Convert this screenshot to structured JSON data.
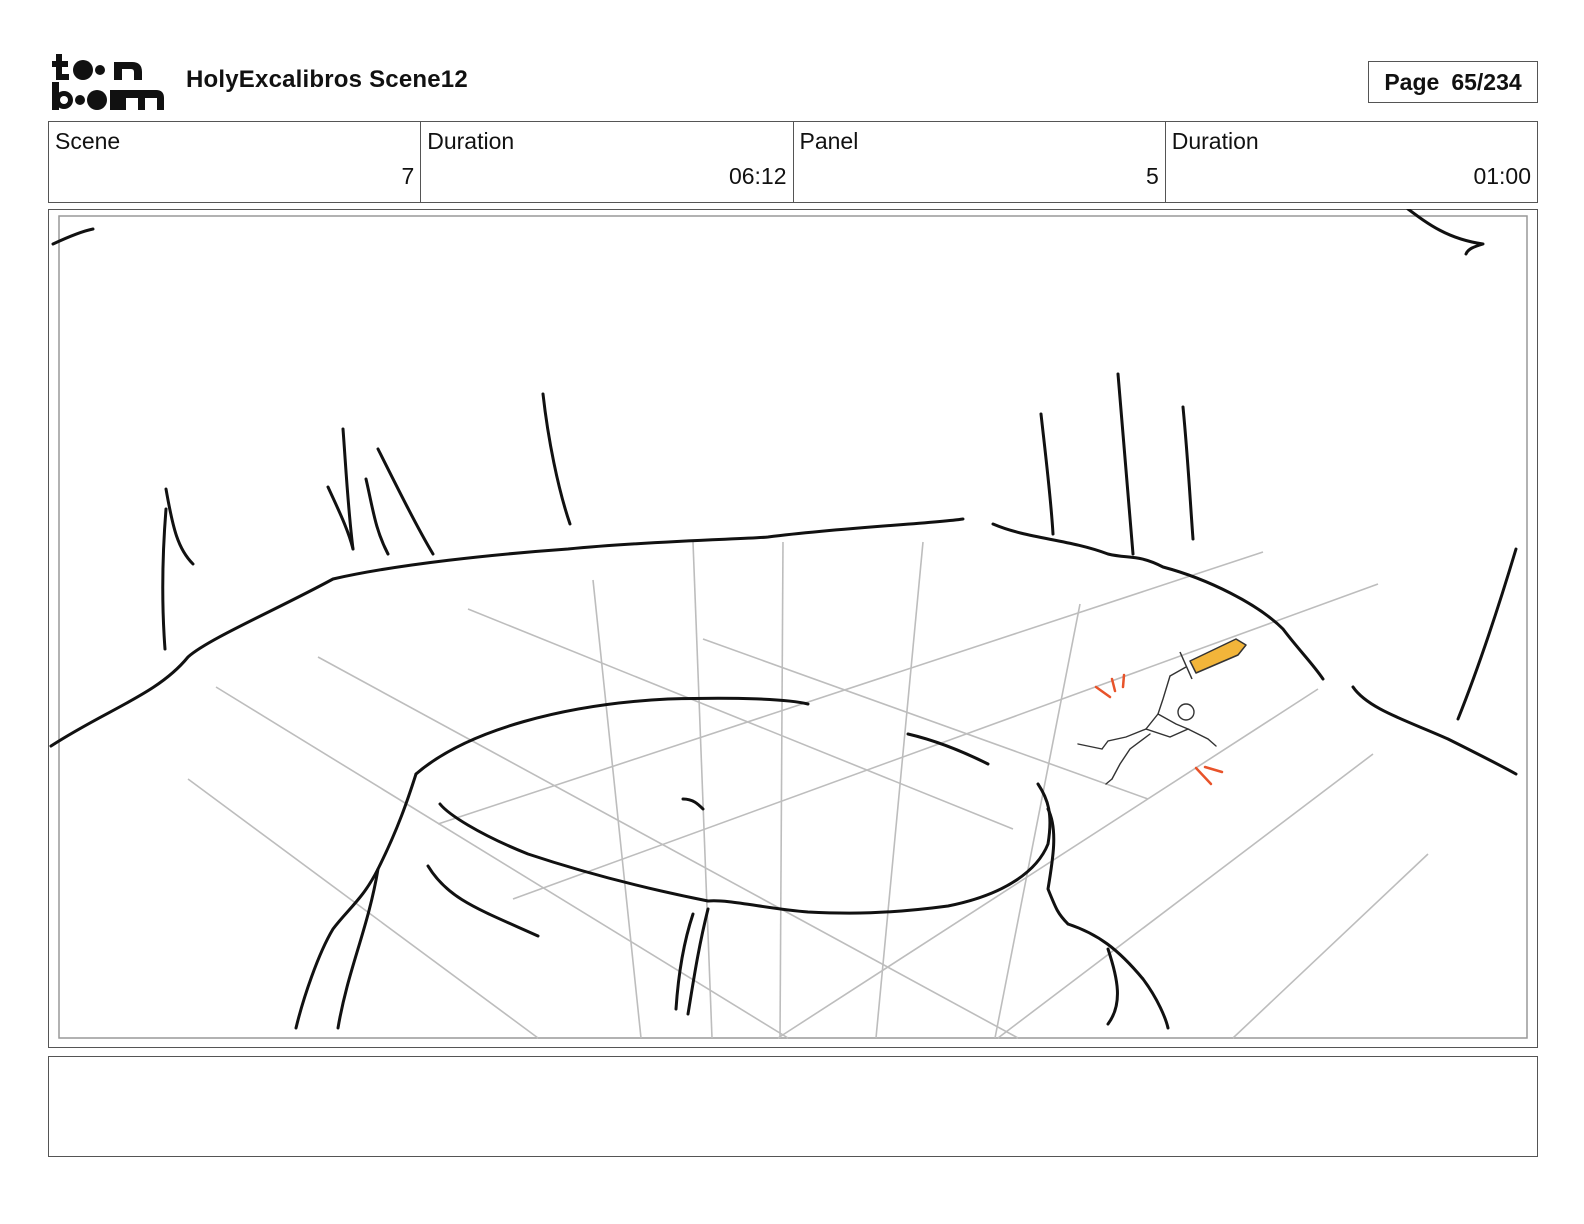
{
  "header": {
    "logo_text_top": "toon",
    "logo_text_bottom": "boom",
    "project_title": "HolyExcalibros Scene12",
    "page_label": "Page",
    "page_value": "65/234"
  },
  "info": {
    "scene_label": "Scene",
    "scene_value": "7",
    "scene_duration_label": "Duration",
    "scene_duration_value": "06:12",
    "panel_label": "Panel",
    "panel_value": "5",
    "panel_duration_label": "Duration",
    "panel_duration_value": "01:00"
  },
  "panel": {
    "description": "",
    "colors": {
      "sketch": "#111111",
      "guides": "#bdbdbd",
      "sword": "#f2b53a",
      "impact": "#e8532a"
    }
  },
  "notes": {
    "text": ""
  }
}
